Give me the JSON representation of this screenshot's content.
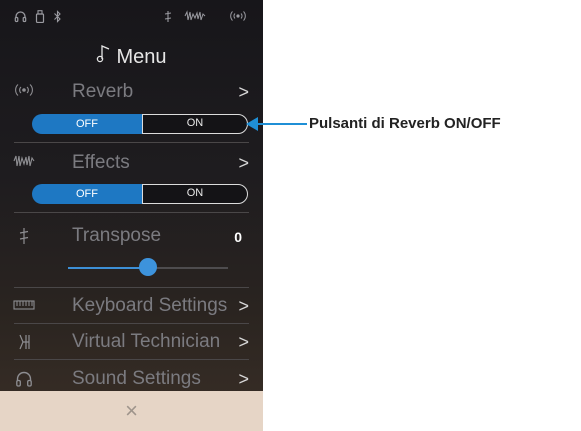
{
  "status_bar": {
    "icons": [
      "headphones-icon",
      "usb-icon",
      "bluetooth-icon",
      "transpose-icon",
      "effects-icon",
      "reverb-icon"
    ]
  },
  "menu": {
    "title": "Menu"
  },
  "reverb": {
    "label": "Reverb",
    "chevron": ">",
    "off_label": "OFF",
    "on_label": "ON",
    "state": "OFF"
  },
  "effects": {
    "label": "Effects",
    "chevron": ">",
    "off_label": "OFF",
    "on_label": "ON",
    "state": "OFF"
  },
  "transpose": {
    "label": "Transpose",
    "value": "0",
    "slider_fraction": 0.5
  },
  "keyboard_settings": {
    "label": "Keyboard Settings",
    "chevron": ">"
  },
  "virtual_technician": {
    "label": "Virtual Technician",
    "chevron": ">"
  },
  "sound_settings": {
    "label": "Sound Settings",
    "chevron": ">"
  },
  "footer": {
    "close": "×"
  },
  "annotation": {
    "text": "Pulsanti di Reverb ON/OFF"
  },
  "colors": {
    "accent": "#1e78c3",
    "callout": "#1f8fd6",
    "footer": "#e6d5c6"
  }
}
